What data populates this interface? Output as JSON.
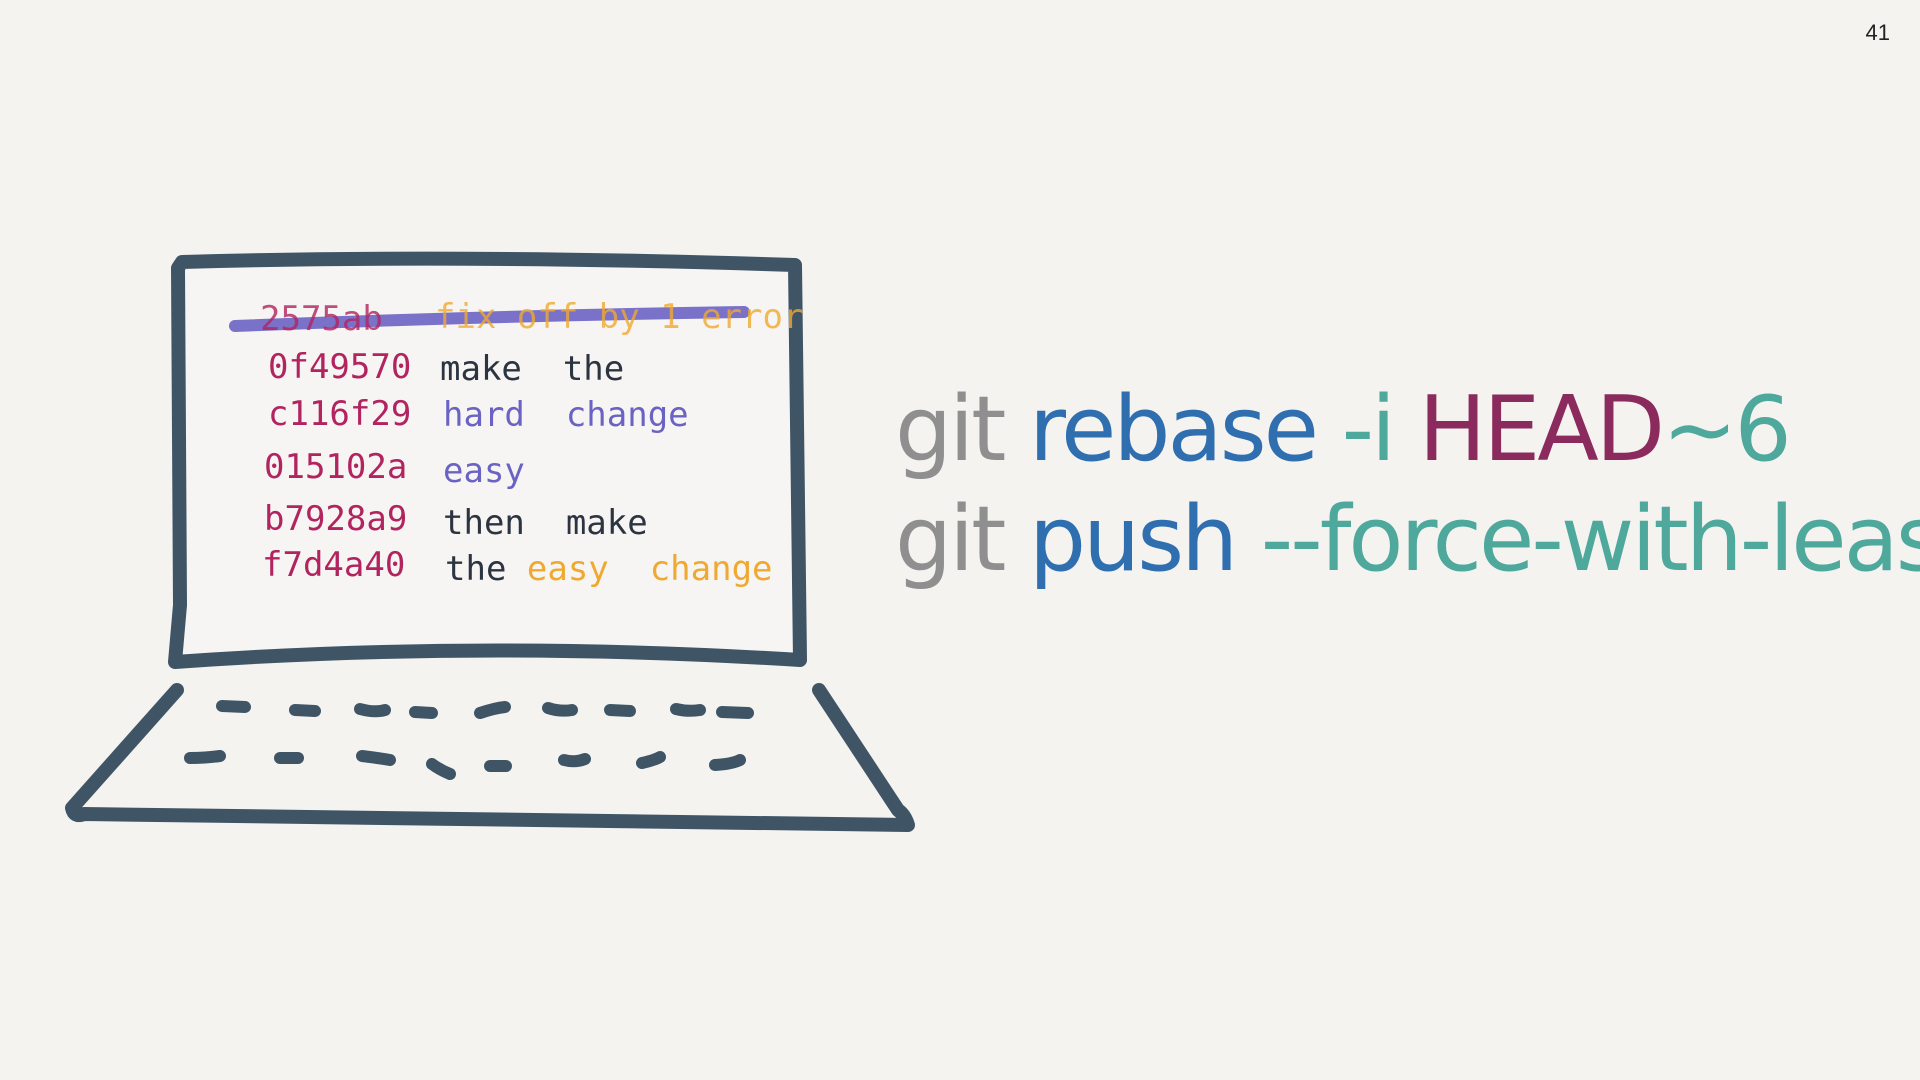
{
  "slide_number": "41",
  "laptop_screen": {
    "commits": [
      {
        "hash": "2575ab",
        "message": [
          {
            "text": "fix off by 1 error",
            "color": "#f0a930"
          }
        ],
        "struck": true
      },
      {
        "hash": "0f49570",
        "message": [
          {
            "text": "make  the",
            "color": "#2b3440"
          }
        ],
        "struck": false
      },
      {
        "hash": "c116f29",
        "message": [
          {
            "text": "hard  change",
            "color": "#6b63c4"
          }
        ],
        "struck": false
      },
      {
        "hash": "015102a",
        "message": [
          {
            "text": "easy",
            "color": "#6b63c4"
          }
        ],
        "struck": false
      },
      {
        "hash": "b7928a9",
        "message": [
          {
            "text": "then  make",
            "color": "#2b3440"
          }
        ],
        "struck": false
      },
      {
        "hash": "f7d4a40",
        "message": [
          {
            "text": "the ",
            "color": "#2b3440"
          },
          {
            "text": "easy  change",
            "color": "#f0a930"
          }
        ],
        "struck": false
      }
    ],
    "hash_color": "#b2245f",
    "strike_color": "#6b63c4"
  },
  "commands": {
    "line1": {
      "git": "git",
      "sub": "rebase",
      "flag": "-i",
      "ref": "HEAD",
      "tilde": "~6"
    },
    "line2": {
      "git": "git",
      "sub": "push",
      "flag": "--force-with-lease"
    }
  },
  "colors": {
    "outline": "#3f5566",
    "git": "#8f8f8f",
    "subcommand": "#2f6fb0",
    "flag": "#4ea89b",
    "ref": "#8b2a5d"
  }
}
